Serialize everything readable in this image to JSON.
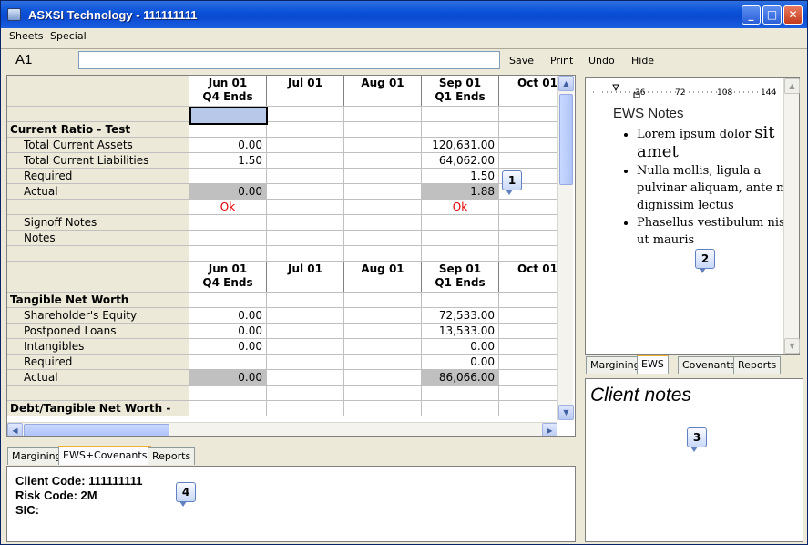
{
  "window": {
    "title": "ASXSI Technology - 111111111",
    "min": "_",
    "max": "□",
    "close": "✕"
  },
  "menu": [
    "Sheets",
    "Special"
  ],
  "formula": {
    "cell_ref": "A1",
    "value": ""
  },
  "toolbar": {
    "save": "Save",
    "print": "Print",
    "undo": "Undo",
    "hide": "Hide"
  },
  "grid": {
    "months": [
      {
        "top": "Jun 01",
        "bottom": "Q4 Ends"
      },
      {
        "top": "Jul 01",
        "bottom": ""
      },
      {
        "top": "Aug 01",
        "bottom": ""
      },
      {
        "top": "Sep 01",
        "bottom": "Q1 Ends"
      },
      {
        "top": "Oct 01",
        "bottom": ""
      }
    ],
    "rows": [
      {
        "label": "",
        "style": "blank",
        "vals": [
          "",
          "",
          "",
          "",
          ""
        ]
      },
      {
        "label": "Current Ratio  - Test",
        "style": "bold",
        "vals": [
          "",
          "",
          "",
          "",
          ""
        ]
      },
      {
        "label": "Total Current Assets",
        "style": "ind",
        "vals": [
          "0.00",
          "",
          "",
          "120,631.00",
          ""
        ]
      },
      {
        "label": "Total Current Liabilities",
        "style": "ind",
        "vals": [
          "1.50",
          "",
          "",
          "64,062.00",
          ""
        ]
      },
      {
        "label": "Required",
        "style": "ind",
        "vals": [
          "",
          "",
          "",
          "1.50",
          ""
        ]
      },
      {
        "label": "Actual",
        "style": "ind",
        "grey": [
          0,
          3
        ],
        "vals": [
          "0.00",
          "",
          "",
          "1.88",
          ""
        ]
      },
      {
        "label": "",
        "style": "status",
        "vals": [
          "Ok",
          "",
          "",
          "Ok",
          ""
        ]
      },
      {
        "label": "Signoff Notes",
        "style": "ind",
        "vals": [
          "",
          "",
          "",
          "",
          ""
        ]
      },
      {
        "label": "Notes",
        "style": "ind",
        "vals": [
          "",
          "",
          "",
          "",
          ""
        ]
      },
      {
        "label": "",
        "style": "blank",
        "vals": [
          "",
          "",
          "",
          "",
          ""
        ]
      },
      {
        "label": "",
        "style": "header",
        "vals": [
          "",
          "",
          "",
          "",
          ""
        ]
      },
      {
        "label": "Tangible Net Worth",
        "style": "bold",
        "vals": [
          "",
          "",
          "",
          "",
          ""
        ]
      },
      {
        "label": "Shareholder's Equity",
        "style": "ind",
        "vals": [
          "0.00",
          "",
          "",
          "72,533.00",
          ""
        ]
      },
      {
        "label": "Postponed Loans",
        "style": "ind",
        "vals": [
          "0.00",
          "",
          "",
          "13,533.00",
          ""
        ]
      },
      {
        "label": "Intangibles",
        "style": "ind",
        "vals": [
          "0.00",
          "",
          "",
          "0.00",
          ""
        ]
      },
      {
        "label": "Required",
        "style": "ind",
        "vals": [
          "",
          "",
          "",
          "0.00",
          ""
        ]
      },
      {
        "label": "Actual",
        "style": "ind",
        "grey": [
          0,
          3
        ],
        "vals": [
          "0.00",
          "",
          "",
          "86,066.00",
          ""
        ]
      },
      {
        "label": "",
        "style": "blank",
        "vals": [
          "",
          "",
          "",
          "",
          ""
        ]
      },
      {
        "label": "Debt/Tangible Net Worth  -",
        "style": "bold",
        "vals": [
          "",
          "",
          "",
          "",
          ""
        ]
      }
    ]
  },
  "bottom_tabs": [
    "Margining",
    "EWS+Covenants",
    "Reports"
  ],
  "client_info": {
    "client_code": "Client Code:  111111111",
    "risk_code": "Risk Code:  2M",
    "sic": "SIC:"
  },
  "ews": {
    "ruler_marks": [
      "36",
      "72",
      "108",
      "144"
    ],
    "title": "EWS Notes",
    "bullets": [
      {
        "pre": "Lorem ipsum dolor ",
        "big": "sit amet"
      },
      {
        "pre": "Nulla mollis, ligula a pulvinar aliquam, ante mi dignissim lectus",
        "big": ""
      },
      {
        "pre": "Phasellus vestibulum nisi ut mauris",
        "big": ""
      }
    ]
  },
  "right_tabs": [
    "Margining",
    "EWS",
    "Covenants",
    "Reports"
  ],
  "client_notes": {
    "title": "Client notes"
  },
  "callouts": [
    "1",
    "2",
    "3",
    "4"
  ]
}
